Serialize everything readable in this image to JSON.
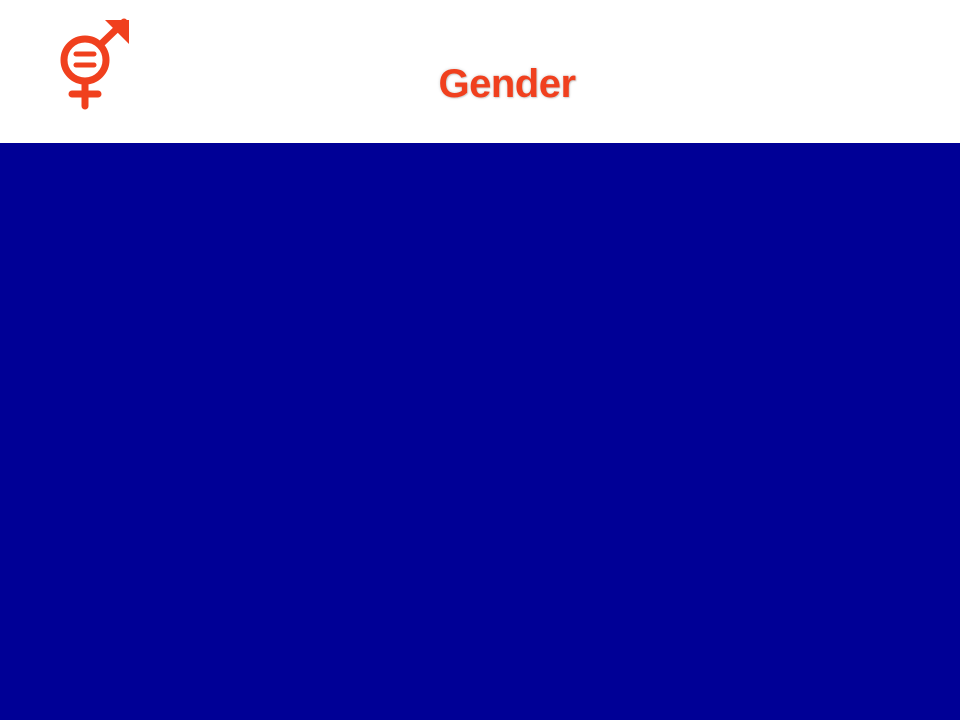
{
  "slide": {
    "title": "Gender",
    "icon": "gender-equality-icon",
    "colors": {
      "accent": "#f0401e",
      "content_background": "#000096",
      "header_background": "#ffffff"
    }
  }
}
